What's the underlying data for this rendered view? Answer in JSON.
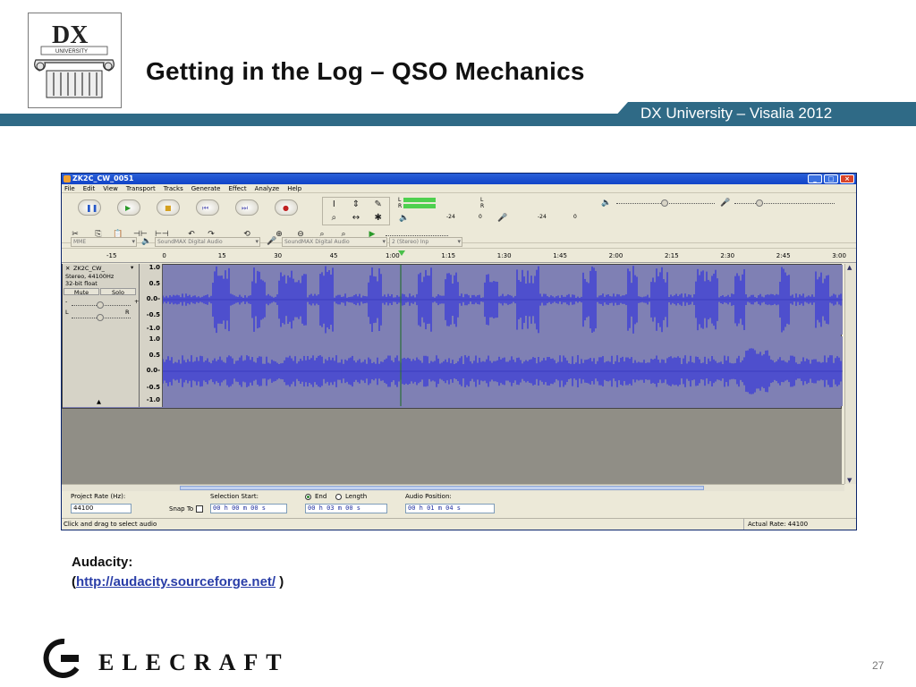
{
  "slide": {
    "title": "Getting in the Log – QSO Mechanics",
    "subtitle": "DX University – Visalia 2012",
    "logo_text": "DX",
    "logo_subtext": "UNIVERSITY",
    "page_number": "27",
    "footer_brand": "ELECRAFT",
    "colors": {
      "header_bar": "#2f6a86",
      "link": "#2a3ea8",
      "waveform": "#3a3ad8",
      "track_bg": "#7f80b4"
    }
  },
  "caption": {
    "label": "Audacity:",
    "open_paren": "(",
    "link_text": "http://audacity.sourceforge.net/",
    "close_paren": " )"
  },
  "window": {
    "title": "ZK2C_CW_0051",
    "menu": [
      "File",
      "Edit",
      "View",
      "Transport",
      "Tracks",
      "Generate",
      "Effect",
      "Analyze",
      "Help"
    ],
    "transport_buttons": [
      "pause",
      "play",
      "stop",
      "skip-start",
      "skip-end",
      "record"
    ],
    "meter": {
      "left_label": "L",
      "right_label": "R",
      "scale_a": "-24",
      "scale_b": "0",
      "scale_c": "-24",
      "scale_d": "0",
      "level": 0.45
    },
    "devices": {
      "host": "MME",
      "output": "SoundMAX Digital Audio",
      "input": "SoundMAX Digital Audio",
      "channels": "2 (Stereo) Inp"
    },
    "ruler_ticks": [
      "-15",
      "0",
      "15",
      "30",
      "45",
      "1:00",
      "1:15",
      "1:30",
      "1:45",
      "2:00",
      "2:15",
      "2:30",
      "2:45",
      "3:00"
    ],
    "track": {
      "name": "ZK2C_CW_",
      "info1": "Stereo, 44100Hz",
      "info2": "32-bit float",
      "mute": "Mute",
      "solo": "Solo",
      "gain_minus": "-",
      "gain_plus": "+",
      "pan_left": "L",
      "pan_right": "R",
      "scale": [
        "1.0",
        "0.5",
        "0.0-",
        "-0.5",
        "-1.0",
        "1.0",
        "0.5",
        "0.0-",
        "-0.5",
        "-1.0"
      ]
    },
    "selection_bar": {
      "project_rate_label": "Project Rate (Hz):",
      "project_rate_value": "44100",
      "snap_to_label": "Snap To",
      "selection_start_label": "Selection Start:",
      "end_label": "End",
      "length_label": "Length",
      "audio_position_label": "Audio Position:",
      "selection_start_value": "00 h 00 m 00 s",
      "end_value": "00 h 03 m 00 s",
      "audio_position_value": "00 h 01 m 04 s"
    },
    "status": {
      "hint": "Click and drag to select audio",
      "actual_rate": "Actual Rate: 44100"
    }
  }
}
